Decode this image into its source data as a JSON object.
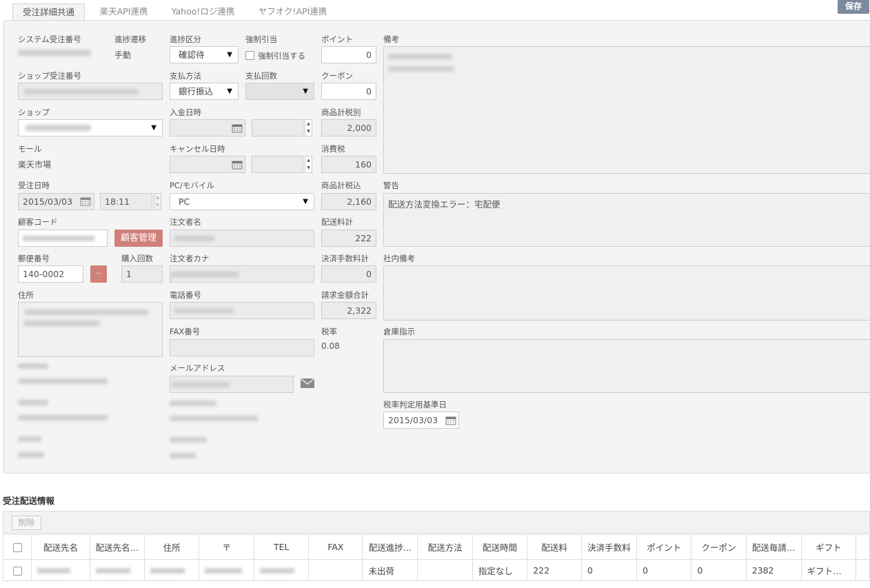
{
  "tabs": [
    "受注詳細共通",
    "楽天API連携",
    "Yahoo!ロジ連携",
    "ヤフオク!API連携"
  ],
  "save_label": "保存",
  "labels": {
    "system_order_no": "システム受注番号",
    "progress_transition": "進捗遷移",
    "progress_status": "進捗区分",
    "forced_allocation": "強制引当",
    "points": "ポイント",
    "remarks": "備考",
    "shop_order_no": "ショップ受注番号",
    "payment_method": "支払方法",
    "payment_count": "支払回数",
    "coupon": "クーポン",
    "shop": "ショップ",
    "deposit_datetime": "入金日時",
    "subtotal_excl_tax": "商品計税別",
    "mall": "モール",
    "cancel_datetime": "キャンセル日時",
    "consumption_tax": "消費税",
    "order_datetime": "受注日時",
    "pc_mobile": "PC/モバイル",
    "subtotal_incl_tax": "商品計税込",
    "warning": "警告",
    "customer_code": "顧客コード",
    "orderer_name": "注文者名",
    "shipping_total": "配送料計",
    "postal_code": "郵便番号",
    "purchase_count": "購入回数",
    "orderer_kana": "注文者カナ",
    "settlement_fee_total": "決済手数料計",
    "internal_remarks": "社内備考",
    "address": "住所",
    "phone": "電話番号",
    "billing_total": "請求金額合計",
    "fax": "FAX番号",
    "tax_rate": "税率",
    "warehouse_instructions": "倉庫指示",
    "email": "メールアドレス",
    "tax_rate_base_date": "税率判定用基準日"
  },
  "values": {
    "progress_transition": "手動",
    "progress_status": "確認待",
    "forced_allocation_checkbox": "強制引当する",
    "points": "0",
    "payment_method": "銀行振込",
    "coupon": "0",
    "subtotal_excl_tax": "2,000",
    "mall": "楽天市場",
    "consumption_tax": "160",
    "order_date": "2015/03/03",
    "order_time": "18:11",
    "pc_mobile": "PC",
    "subtotal_incl_tax": "2,160",
    "warning": "配送方法変換エラー：宅配便",
    "customer_mgmt_button": "顧客管理",
    "shipping_total": "222",
    "postal_code": "140-0002",
    "postal_lookup_button": "···",
    "purchase_count": "1",
    "settlement_fee_total": "0",
    "billing_total": "2,322",
    "tax_rate": "0.08",
    "tax_rate_base_date": "2015/03/03"
  },
  "shipping": {
    "title": "受注配送情報",
    "delete_label": "削除",
    "columns": [
      "配送先名",
      "配送先名…",
      "住所",
      "〒",
      "TEL",
      "FAX",
      "配送進捗…",
      "配送方法",
      "配送時間",
      "配送料",
      "決済手数料",
      "ポイント",
      "クーポン",
      "配送毎請…",
      "ギフト"
    ],
    "row": {
      "status": "未出荷",
      "delivery_time": "指定なし",
      "shipping_fee": "222",
      "settlement_fee": "0",
      "points": "0",
      "coupon": "0",
      "billing": "2382",
      "gift": "ギフト…"
    }
  },
  "icons": [
    "calendar-icon",
    "envelope-icon",
    "dropdown-arrow-icon",
    "spinner-icon"
  ],
  "colors": {
    "save_button": "#7d8a9d",
    "red_button": "#cf8078",
    "panel_bg": "#f4f4f4"
  }
}
